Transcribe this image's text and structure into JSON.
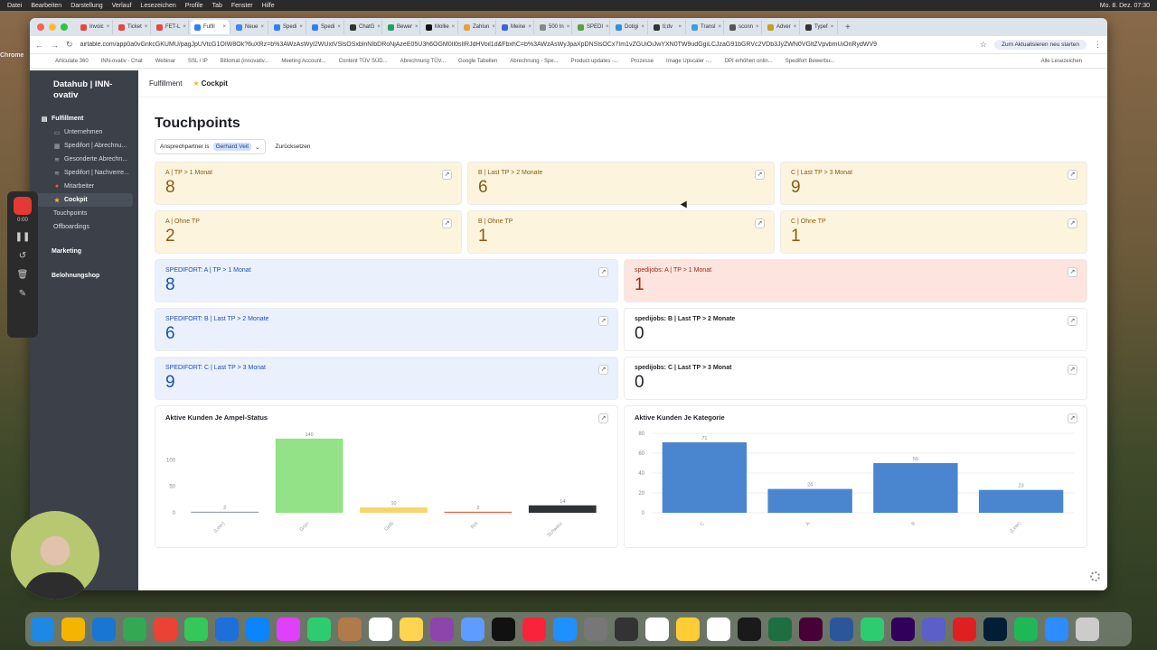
{
  "menubar": {
    "app": "Chrome",
    "items": [
      "Datei",
      "Bearbeiten",
      "Darstellung",
      "Verlauf",
      "Lesezeichen",
      "Profile",
      "Tab",
      "Fenster",
      "Hilfe"
    ],
    "clock": "Mo. 8. Dez. 07:30"
  },
  "browser": {
    "tabs": [
      {
        "label": "Invoic",
        "color": "#e8453c"
      },
      {
        "label": "Ticket",
        "color": "#e8453c"
      },
      {
        "label": "FET-L",
        "color": "#e8453c"
      },
      {
        "label": "Fulfil",
        "color": "#2d7ff9",
        "active": true
      },
      {
        "label": "Neue",
        "color": "#4285f4"
      },
      {
        "label": "Spedi",
        "color": "#2d7ff9"
      },
      {
        "label": "Spedi",
        "color": "#2d7ff9"
      },
      {
        "label": "ChatG",
        "color": "#333333"
      },
      {
        "label": "Bewer",
        "color": "#20a060"
      },
      {
        "label": "Mollie",
        "color": "#111111"
      },
      {
        "label": "Zahlun",
        "color": "#e8a13c"
      },
      {
        "label": "Meine",
        "color": "#4060e0"
      },
      {
        "label": "500 In",
        "color": "#888888"
      },
      {
        "label": "SPEDI",
        "color": "#58a040"
      },
      {
        "label": "Dotigi",
        "color": "#3090e0"
      },
      {
        "label": "ti;dv",
        "color": "#333333"
      },
      {
        "label": "Transl",
        "color": "#3aa0e0"
      },
      {
        "label": "sconn",
        "color": "#555555"
      },
      {
        "label": "Adver",
        "color": "#c0a020"
      },
      {
        "label": "Typef",
        "color": "#333333"
      }
    ],
    "url": "airtable.com/app0a0vGnkcGKUMU/pagJpUVtcG1OIW8Ok?6uXRz=b%3AWzAsWyI2WUxtVSlsOSxblnNIbDRoNjAzeE05U3h6OGM0Il0slIRJdHVoil1d&FbxhC=b%3AWzAsWyJpaXpDNSlsOCx7Im1vZGUiOiJwYXN0TW9udGgiLCJzaG91bGRVc2VDb3JyZWN0VGltZVpvbmUiOnRydWV9",
    "update_button": "Zum Aktualisieren neu starten",
    "bookmarks": [
      "Articulate 360",
      "INN-ovativ - Chat",
      "Webinar",
      "SSL / IP",
      "Bitlomat (innovativ...",
      "Meeting Account...",
      "Content TÜV SÜD...",
      "Abrechnung TÜV...",
      "Google Tabellen",
      "Abrechnung - Spe...",
      "Product updates -...",
      "Prozesse",
      "Image Upscaler -...",
      "DPI erhöhen onlin...",
      "Spedifort Bewerbu..."
    ],
    "all_bookmarks": "Alle Lesezeichen"
  },
  "sidebar": {
    "workspace": "Datahub | INN-ovativ",
    "groups": [
      {
        "label": "Fulfillment",
        "icon": "page-icon",
        "items": [
          {
            "label": "Unternehmen",
            "icon": "doc-icon"
          },
          {
            "label": "Spedifort | Abrechnu...",
            "icon": "table-icon"
          },
          {
            "label": "Gesonderte Abrechn...",
            "icon": "layers-icon"
          },
          {
            "label": "Spedifort | Nachverre...",
            "icon": "layers-icon"
          },
          {
            "label": "Mitarbeiter",
            "icon": "person-icon"
          },
          {
            "label": "Cockpit",
            "icon": "star-icon",
            "active": true
          },
          {
            "label": "Touchpoints",
            "icon": ""
          },
          {
            "label": "Offboardings",
            "icon": ""
          }
        ]
      },
      {
        "label": "Marketing",
        "items": []
      },
      {
        "label": "Belohnungshop",
        "items": []
      }
    ]
  },
  "header": {
    "breadcrumb": [
      "Fulfillment",
      "Cockpit"
    ]
  },
  "page": {
    "title": "Touchpoints",
    "filter": {
      "field": "Ansprechpartner is",
      "value": "Gerhard Veit",
      "reset": "Zurücksetzen"
    }
  },
  "cards_row1": [
    {
      "label": "A | TP > 1 Monat",
      "value": "8",
      "style": "yellow"
    },
    {
      "label": "B | Last TP > 2 Monate",
      "value": "6",
      "style": "yellow"
    },
    {
      "label": "C | Last TP > 3 Monat",
      "value": "9",
      "style": "yellow"
    }
  ],
  "cards_row2": [
    {
      "label": "A | Ohne TP",
      "value": "2",
      "style": "yellow"
    },
    {
      "label": "B | Ohne TP",
      "value": "1",
      "style": "yellow"
    },
    {
      "label": "C | Ohne TP",
      "value": "1",
      "style": "yellow"
    }
  ],
  "cards_pairs": [
    [
      {
        "label": "SPEDIFORT: A | TP > 1 Monat",
        "value": "8",
        "style": "blue"
      },
      {
        "label": "spedijobs: A | TP > 1 Monat",
        "value": "1",
        "style": "red"
      }
    ],
    [
      {
        "label": "SPEDIFORT: B | Last TP > 2 Monate",
        "value": "6",
        "style": "blue"
      },
      {
        "label": "spedijobs: B | Last TP > 2 Monate",
        "value": "0",
        "style": "white"
      }
    ],
    [
      {
        "label": "SPEDIFORT: C | Last TP > 3 Monat",
        "value": "9",
        "style": "blue"
      },
      {
        "label": "spedijobs: C | Last TP > 3 Monat",
        "value": "0",
        "style": "white"
      }
    ]
  ],
  "chart_data": [
    {
      "type": "bar",
      "title": "Aktive Kunden Je Ampel-Status",
      "categories": [
        "(Leer)",
        "Grün",
        "Gelb",
        "Rot",
        "Schwarz"
      ],
      "values": [
        2,
        140,
        10,
        2,
        14
      ],
      "colors": [
        "#9aa0a6",
        "#93e287",
        "#f7d56b",
        "#e8603c",
        "#2f3338"
      ],
      "yticks": [
        0,
        50,
        100
      ],
      "ylim": [
        0,
        150
      ],
      "grid": false
    },
    {
      "type": "bar",
      "title": "Aktive Kunden Je Kategorie",
      "categories": [
        "C",
        "A",
        "B",
        "(Leer)"
      ],
      "values": [
        71,
        24,
        50,
        23
      ],
      "colors": [
        "#4a86d0",
        "#4a86d0",
        "#4a86d0",
        "#4a86d0"
      ],
      "yticks": [
        0,
        20,
        40,
        60,
        80
      ],
      "ylim": [
        0,
        80
      ],
      "grid": true
    }
  ],
  "zoom_overlay": {
    "time": "0:00"
  }
}
